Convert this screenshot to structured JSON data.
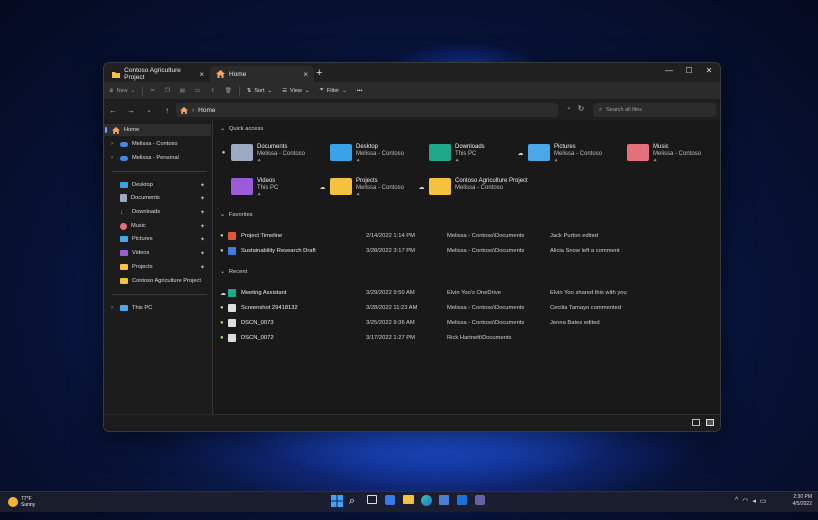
{
  "window": {
    "tabs": [
      {
        "label": "Contoso Agriculture Project",
        "icon": "folder-icon"
      },
      {
        "label": "Home",
        "icon": "home-icon"
      }
    ]
  },
  "toolbar": {
    "new_label": "New",
    "sort_label": "Sort",
    "view_label": "View",
    "filter_label": "Filter",
    "more_label": "•••"
  },
  "address": {
    "path": "Home",
    "search_placeholder": "Search all files"
  },
  "sidebar": {
    "home": "Home",
    "cloud": [
      "Melissa - Contoso",
      "Melissa - Personal"
    ],
    "pinned": [
      "Desktop",
      "Documents",
      "Downloads",
      "Music",
      "Pictures",
      "Videos",
      "Projects",
      "Contoso Agriculture Project"
    ],
    "this_pc": "This PC"
  },
  "main": {
    "quick_access_label": "Quick access",
    "quick_access": [
      {
        "name": "Documents",
        "loc": "Melissa - Contoso",
        "color": "#9ca9c2"
      },
      {
        "name": "Desktop",
        "loc": "Melissa - Contoso",
        "color": "#3aa2e8"
      },
      {
        "name": "Downloads",
        "loc": "This PC",
        "color": "#1fa98a"
      },
      {
        "name": "Pictures",
        "loc": "Melissa - Contoso",
        "color": "#4aa8e8"
      },
      {
        "name": "Music",
        "loc": "Melissa - Contoso",
        "color": "#e3707a"
      },
      {
        "name": "Videos",
        "loc": "This PC",
        "color": "#9c5bd9"
      },
      {
        "name": "Projects",
        "loc": "Melissa - Contoso",
        "color": "#f3c23f"
      },
      {
        "name": "Contoso Agriculture Project",
        "loc": "Melissa - Contoso",
        "color": "#f3c23f"
      }
    ],
    "favorites_label": "Favorites",
    "favorites": [
      {
        "name": "Project Timeline",
        "date": "2/14/2022 1:14 PM",
        "location": "Melissa - Contoso\\Documents",
        "activity": "Jack Purton edited",
        "color": "#e5533b"
      },
      {
        "name": "Sustainability Research Draft",
        "date": "3/28/2022 3:17 PM",
        "location": "Melissa - Contoso\\Documents",
        "activity": "Alicia Snow left a comment",
        "color": "#3c7ee8"
      }
    ],
    "recent_label": "Recent",
    "recent": [
      {
        "name": "Meeting Assistant",
        "date": "3/29/2022 9:50 AM",
        "location": "Elvin Yoo's OneDrive",
        "activity": "Elvin Yoo shared this with you",
        "color": "#1fa98a"
      },
      {
        "name": "Screenshot 29418132",
        "date": "3/28/2022 11:23 AM",
        "location": "Melissa - Contoso\\Documents",
        "activity": "Cecilia Tamayo commented",
        "color": "#dddddd"
      },
      {
        "name": "DSCN_0073",
        "date": "3/25/2022 9:36 AM",
        "location": "Melissa - Contoso\\Documents",
        "activity": "Jenna Bates edited",
        "color": "#dddddd"
      },
      {
        "name": "DSCN_0072",
        "date": "3/17/2022 1:27 PM",
        "location": "Rick Hartnett\\Documents",
        "activity": "",
        "color": "#dddddd"
      }
    ]
  },
  "taskbar": {
    "weather_temp": "77°F",
    "weather_desc": "Sunny",
    "time": "2:30 PM",
    "date": "4/5/2022"
  }
}
